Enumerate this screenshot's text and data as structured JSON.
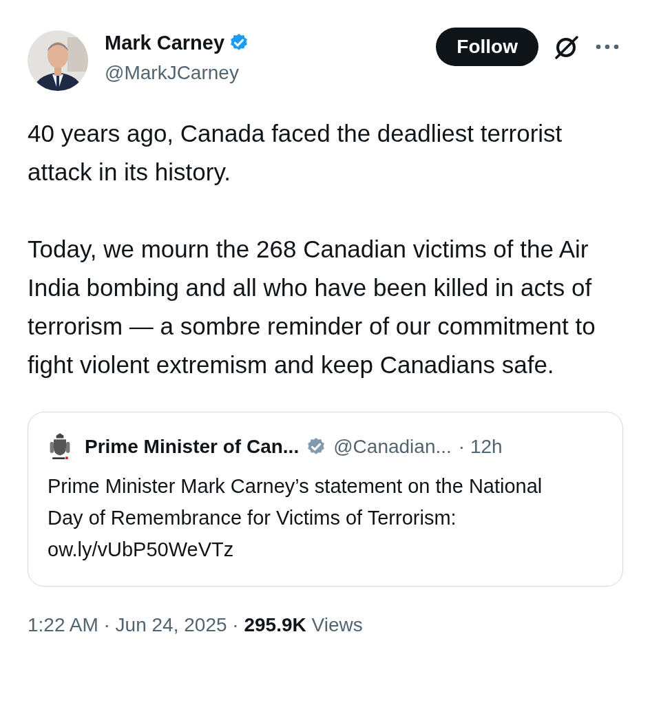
{
  "author": {
    "name": "Mark Carney",
    "verified_badge": {
      "color": "#1d9bf0"
    },
    "handle": "@MarkJCarney"
  },
  "follow_button": "Follow",
  "paragraphs": [
    "40 years ago, Canada faced the deadliest terrorist attack in its history.",
    "Today, we mourn the 268 Canadian victims of the Air India bombing and all who have been killed in acts of terrorism — a sombre reminder of our commitment to fight violent extremism and keep Canadians safe."
  ],
  "quoted_post": {
    "name": "Prime Minister of Can...",
    "verified_badge": {
      "color": "#829aab"
    },
    "handle": "@Canadian...",
    "time": "· 12h",
    "text": "Prime Minister Mark Carney’s statement on the National Day of Remembrance for Victims of Terrorism: ow.ly/vUbP50WeVTz"
  },
  "footer": "1:22 AM · Jun 24, 2025 · **295.9K** Views"
}
